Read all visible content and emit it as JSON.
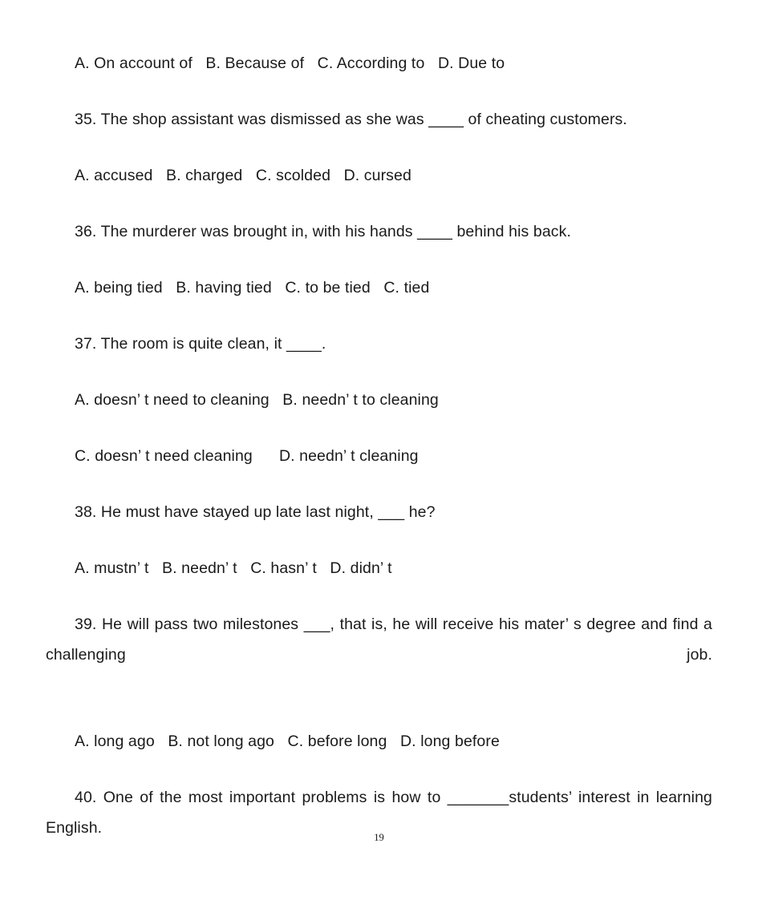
{
  "document": {
    "page_number": "19",
    "background_color": "#ffffff",
    "text_color": "#1a1a1a"
  },
  "blocks": [
    {
      "kind": "options",
      "name": "options-q34",
      "text": "A. On account of   B. Because of   C. According to   D. Due to"
    },
    {
      "kind": "question",
      "name": "question-35",
      "text": "35. The shop assistant was dismissed as she was ____ of cheating customers."
    },
    {
      "kind": "options",
      "name": "options-q35",
      "text": "A. accused   B. charged   C. scolded   D. cursed"
    },
    {
      "kind": "question",
      "name": "question-36",
      "text": "36. The murderer was brought in, with his hands ____ behind his back."
    },
    {
      "kind": "options",
      "name": "options-q36",
      "text": "A. being tied   B. having tied   C. to be tied   C. tied"
    },
    {
      "kind": "question",
      "name": "question-37",
      "text": "37. The room is quite clean, it ____."
    },
    {
      "kind": "options",
      "name": "options-q37-line1",
      "text": "A. doesn’ t need to cleaning   B. needn’ t to cleaning"
    },
    {
      "kind": "options",
      "name": "options-q37-line2",
      "text": "C. doesn’ t need cleaning      D. needn’ t cleaning"
    },
    {
      "kind": "question",
      "name": "question-38",
      "text": "38. He must have stayed up late last night, ___ he?"
    },
    {
      "kind": "options",
      "name": "options-q38",
      "text": "A. mustn’ t   B. needn’ t   C. hasn’ t   D. didn’ t"
    },
    {
      "kind": "question-wrapped",
      "name": "question-39",
      "text": "39. He will pass two milestones ___, that is, he will receive his mater’ s degree and find a challenging job."
    },
    {
      "kind": "options",
      "name": "options-q39",
      "text": "A. long ago   B. not long ago   C. before long   D. long before"
    },
    {
      "kind": "question-wrapped",
      "name": "question-40",
      "text": "40. One of the most important problems is how to _______students’  interest in learning English."
    }
  ]
}
